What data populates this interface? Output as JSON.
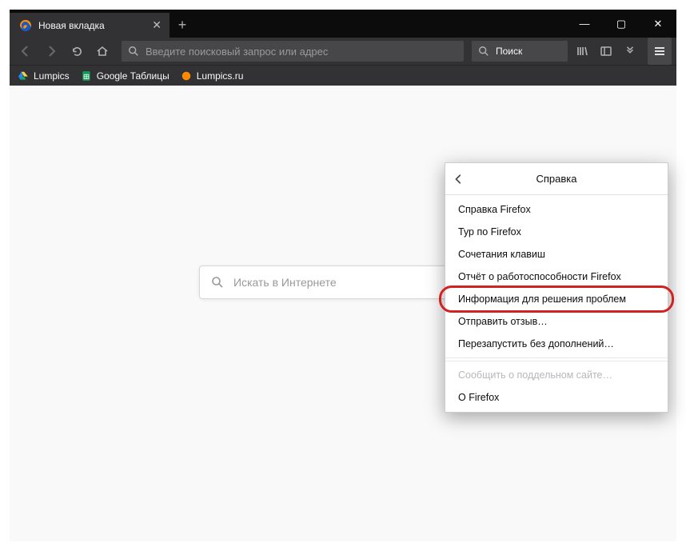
{
  "tab": {
    "title": "Новая вкладка"
  },
  "window_controls": {
    "min": "—",
    "max": "▢",
    "close": "✕"
  },
  "toolbar": {
    "url_placeholder": "Введите поисковый запрос или адрес",
    "search_label": "Поиск"
  },
  "bookmarks": [
    {
      "label": "Lumpics",
      "icon": "drive"
    },
    {
      "label": "Google Таблицы",
      "icon": "sheets"
    },
    {
      "label": "Lumpics.ru",
      "icon": "orange"
    }
  ],
  "content": {
    "search_placeholder": "Искать в Интернете"
  },
  "panel": {
    "title": "Справка",
    "items": [
      {
        "label": "Справка Firefox"
      },
      {
        "label": "Тур по Firefox"
      },
      {
        "label": "Сочетания клавиш"
      },
      {
        "label": "Отчёт о работоспособности Firefox"
      },
      {
        "label": "Информация для решения проблем",
        "highlight": true
      },
      {
        "label": "Отправить отзыв…"
      },
      {
        "label": "Перезапустить без дополнений…"
      },
      {
        "label": "Сообщить о поддельном сайте…",
        "disabled": true
      },
      {
        "label": "О Firefox"
      }
    ]
  }
}
